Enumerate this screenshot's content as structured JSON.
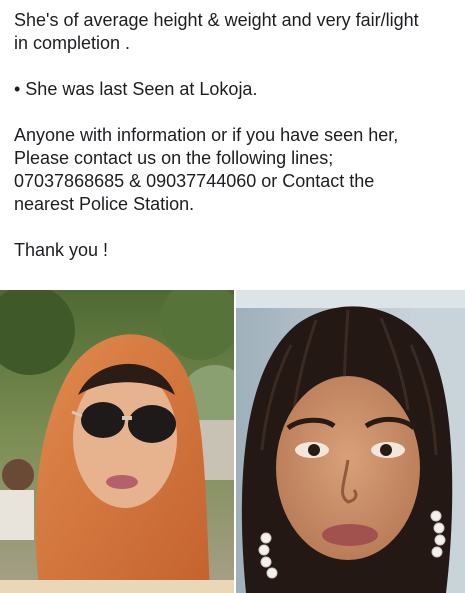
{
  "post": {
    "lines": [
      "She's of average height & weight and very fair/light",
      "in completion .",
      "",
      "• She was last Seen at Lokoja.",
      "",
      "Anyone with information or if you have seen her,",
      "Please contact us on the following lines;",
      "07037868685 & 09037744060 or Contact the",
      "nearest Police Station.",
      "",
      "Thank you !"
    ]
  },
  "photos": [
    {
      "id": "left",
      "description_icon": "person-photo-icon"
    },
    {
      "id": "right",
      "description_icon": "person-photo-icon"
    }
  ],
  "colors": {
    "text": "#1c1e21",
    "hijab": "#d9773f",
    "skin_left": "#e7b38e",
    "skin_right": "#c98e67",
    "foliage": "#5d7a3a",
    "bg_right": "#b8c6cf"
  }
}
